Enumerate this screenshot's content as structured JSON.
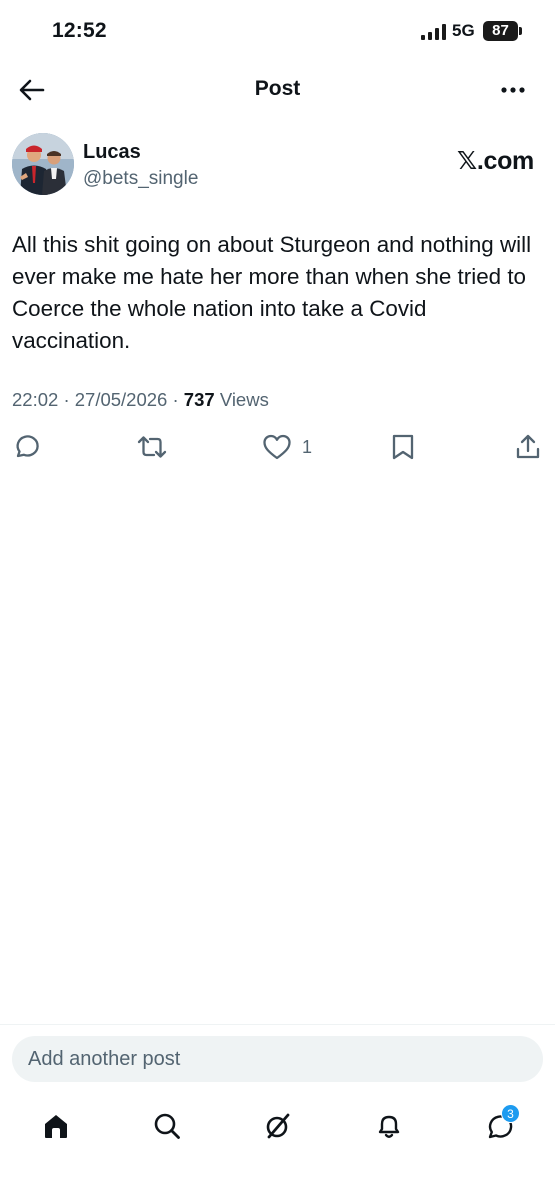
{
  "status_bar": {
    "time": "12:52",
    "network": "5G",
    "battery": "87"
  },
  "header": {
    "title": "Post",
    "back_icon": "arrow-left-icon",
    "more_icon": "more-horizontal-icon"
  },
  "post": {
    "author": {
      "name": "Lucas",
      "handle": "@bets_single"
    },
    "source": "𝕏.com",
    "text": "All this shit going on about Sturgeon and nothing will ever make me hate her more than when she tried to Coerce the whole nation into take a Covid vaccination.",
    "time": "22:02",
    "date": "27/05/2026",
    "separator": "·",
    "views_count": "737",
    "views_label": "Views",
    "actions": {
      "reply_icon": "reply-icon",
      "repost_icon": "repost-icon",
      "like_icon": "heart-icon",
      "like_count": "1",
      "bookmark_icon": "bookmark-icon",
      "share_icon": "share-icon"
    }
  },
  "composer": {
    "placeholder": "Add another post"
  },
  "bottom_nav": {
    "items": [
      "home-icon",
      "search-icon",
      "grok-icon",
      "notifications-icon",
      "messages-icon"
    ],
    "messages_badge": "3"
  },
  "colors": {
    "text": "#0f1419",
    "secondary": "#536471",
    "accent": "#1d9bf0",
    "composer_bg": "#eff3f4"
  }
}
